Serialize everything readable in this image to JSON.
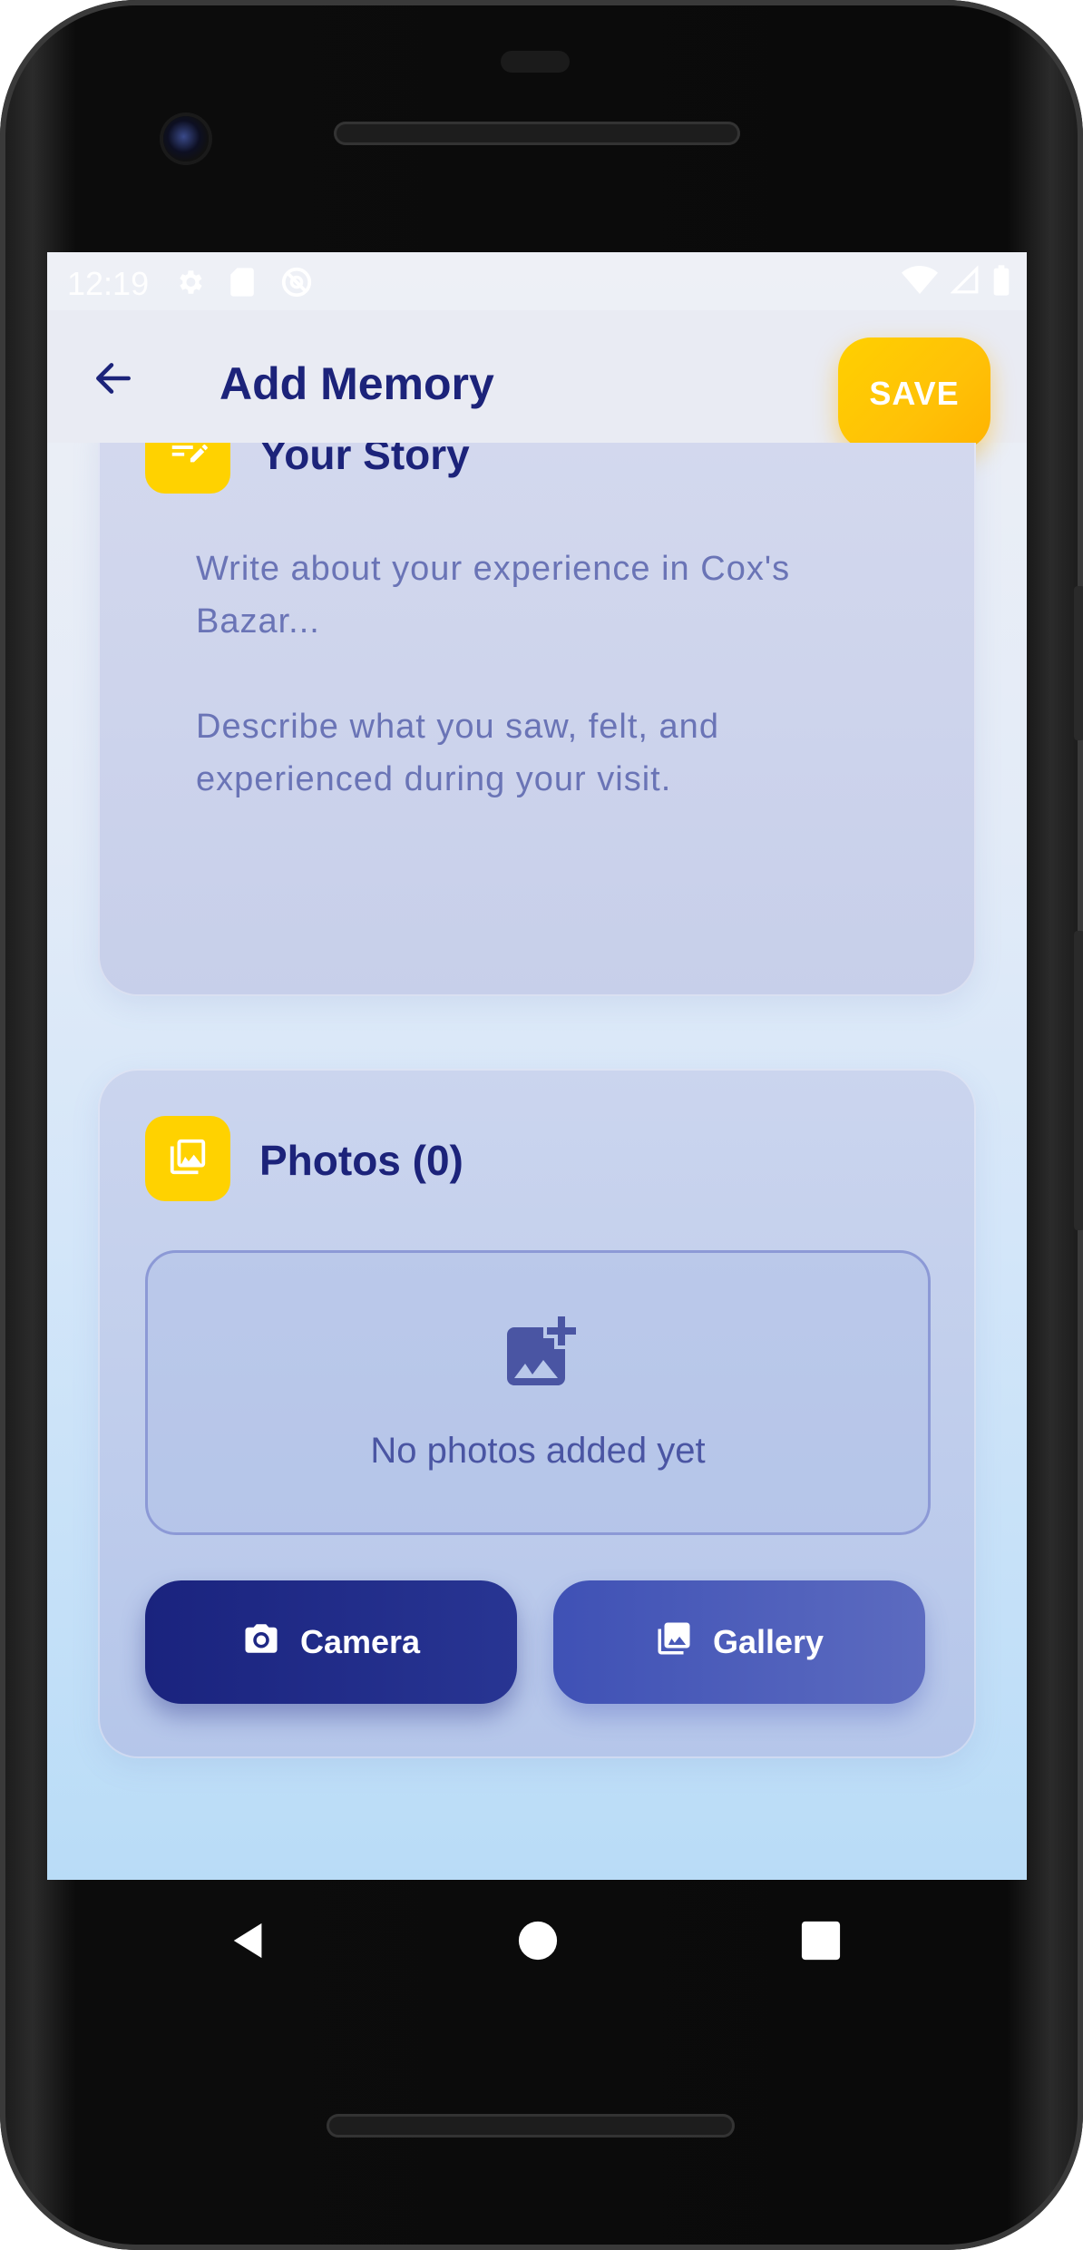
{
  "status_bar": {
    "time": "12:19",
    "left_icons": [
      "settings-icon",
      "sd-card-icon",
      "sync-off-icon"
    ],
    "right_icons": [
      "wifi-icon",
      "signal-icon",
      "battery-icon"
    ]
  },
  "app_bar": {
    "title": "Add Memory",
    "back_icon": "arrow-left-icon",
    "save_label": "SAVE"
  },
  "story_card": {
    "title": "Your Story",
    "icon": "edit-note-icon",
    "placeholder": "Write about your experience in Cox's\nBazar...\n\nDescribe what you saw, felt, and\nexperienced during your visit."
  },
  "photos_card": {
    "title": "Photos (0)",
    "icon": "photo-library-icon",
    "empty_icon": "add-photo-icon",
    "empty_text": "No photos added yet",
    "camera_label": "Camera",
    "gallery_label": "Gallery"
  },
  "nav_bar": {
    "items": [
      "back-triangle-icon",
      "home-circle-icon",
      "recents-square-icon"
    ]
  },
  "colors": {
    "primary": "#1a237e",
    "accent": "#ffc107",
    "secondary": "#3f51b5"
  }
}
